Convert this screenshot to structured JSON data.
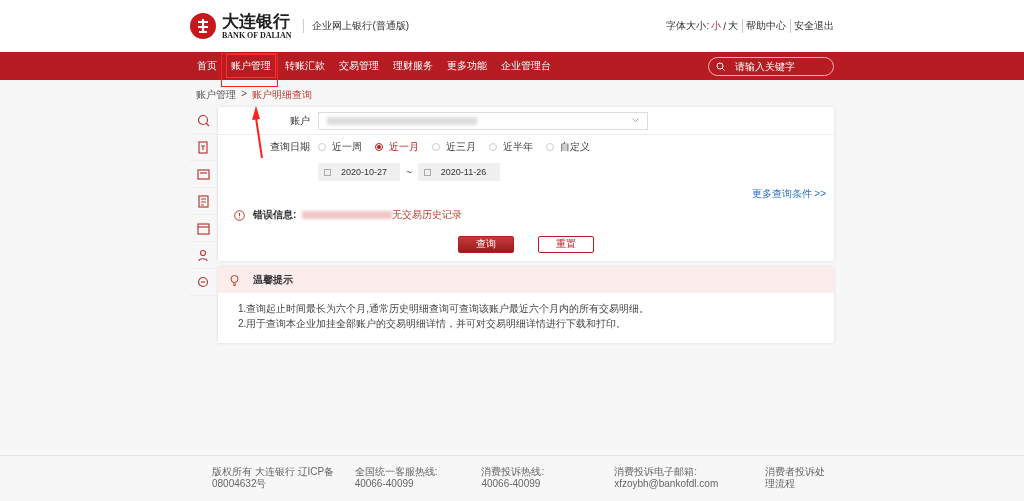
{
  "header": {
    "logo_cn": "大连银行",
    "logo_en": "BANK OF DALIAN",
    "subtitle": "企业网上银行(普通版)",
    "font_size_label": "字体大小:",
    "font_sizes": [
      {
        "label": "小",
        "selected": true
      },
      {
        "label": "大",
        "selected": false
      }
    ],
    "font_size_separator": "/",
    "links": [
      "帮助中心",
      "安全退出"
    ]
  },
  "nav": {
    "items": [
      {
        "label": "首页",
        "selected": false
      },
      {
        "label": "账户管理",
        "selected": true
      },
      {
        "label": "转账汇款",
        "selected": false
      },
      {
        "label": "交易管理",
        "selected": false
      },
      {
        "label": "理财服务",
        "selected": false
      },
      {
        "label": "更多功能",
        "selected": false
      },
      {
        "label": "企业管理台",
        "selected": false
      }
    ],
    "search": {
      "placeholder": "请输入关键字"
    }
  },
  "breadcrumb": [
    "账户管理",
    ">",
    "账户明细查询"
  ],
  "form": {
    "account_label": "账户",
    "date_label": "查询日期",
    "ranges": [
      {
        "label": "近一周",
        "selected": false
      },
      {
        "label": "近一月",
        "selected": true
      },
      {
        "label": "近三月",
        "selected": false
      },
      {
        "label": "近半年",
        "selected": false
      },
      {
        "label": "自定义",
        "selected": false
      }
    ],
    "start_date": "2020-10-27",
    "separator": "~",
    "end_date": "2020-11-26",
    "more_link": "更多查询条件 >>",
    "error_label": "错误信息:",
    "error_text": "无交易历史记录",
    "buttons": [
      {
        "label": "查询",
        "kind": "primary"
      },
      {
        "label": "重置",
        "kind": "secondary"
      }
    ]
  },
  "tips": {
    "title": "温馨提示",
    "lines": [
      "1.查询起止时间最长为六个月,通常历史明细查询可查询该账户最近六个月内的所有交易明细。",
      "2.用于查询本企业加挂全部账户的交易明细详情，并可对交易明细详情进行下载和打印。"
    ]
  },
  "footer": [
    {
      "label": "版权所有 大连银行 辽ICP备",
      "value": "08004632号"
    },
    {
      "label": "全国统一客服热线:",
      "value": "40066-40099"
    },
    {
      "label": "消费投诉热线:",
      "value": "40066-40099"
    },
    {
      "label": "消费投诉电子邮箱:",
      "value": "xfzoybh@bankofdl.com"
    },
    {
      "label": "消费者投诉处",
      "value": "理流程"
    }
  ]
}
